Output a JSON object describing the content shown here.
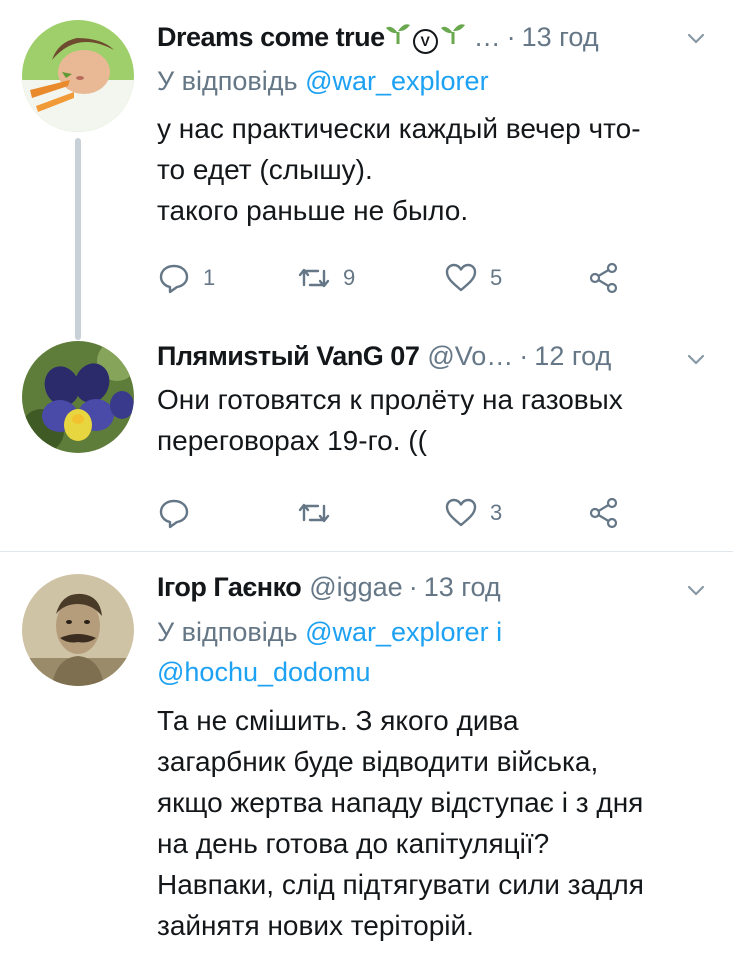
{
  "tweets": [
    {
      "name": "Dreams come true",
      "name_badges": [
        "seedling-icon",
        "verified-circle-v-icon",
        "seedling-icon"
      ],
      "ellipsis": "…",
      "time": "13 год",
      "reply_prefix": "У відповідь",
      "reply_mentions": [
        "@war_explorer"
      ],
      "text_lines": [
        "у нас практически каждый вечер что-",
        "то едет (слышу).",
        "такого раньше не было."
      ],
      "replies": "1",
      "retweets": "9",
      "likes": "5"
    },
    {
      "name": "Плямиѕтый VanG 07",
      "handle": "@Vo…",
      "time": "12 год",
      "text_lines": [
        "Они готовятся к пролёту на газовых",
        "переговорах 19-го. (("
      ],
      "replies": "",
      "retweets": "",
      "likes": "3"
    },
    {
      "name": "Ігор Гаєнко",
      "handle": "@iggae",
      "time": "13 год",
      "reply_prefix": "У відповідь",
      "reply_mentions": [
        "@war_explorer",
        "@hochu_dodomu"
      ],
      "reply_joiner": "і",
      "text_lines": [
        "Та не смішить. З якого дива",
        "загарбник буде відводити війська,",
        "якщо жертва нападу відступає і з дня",
        "на день готова до капітуляції?",
        "Навпаки, слід підтягувати сили задля",
        "зайнятя нових теріторій."
      ]
    }
  ],
  "colors": {
    "accent": "#1da1f2",
    "muted": "#657786",
    "text": "#14171a",
    "thread_line": "#c8d0d8"
  },
  "icons": {
    "reply": "reply-icon",
    "retweet": "retweet-icon",
    "like": "heart-icon",
    "share": "share-icon",
    "menu": "chevron-down-icon"
  }
}
